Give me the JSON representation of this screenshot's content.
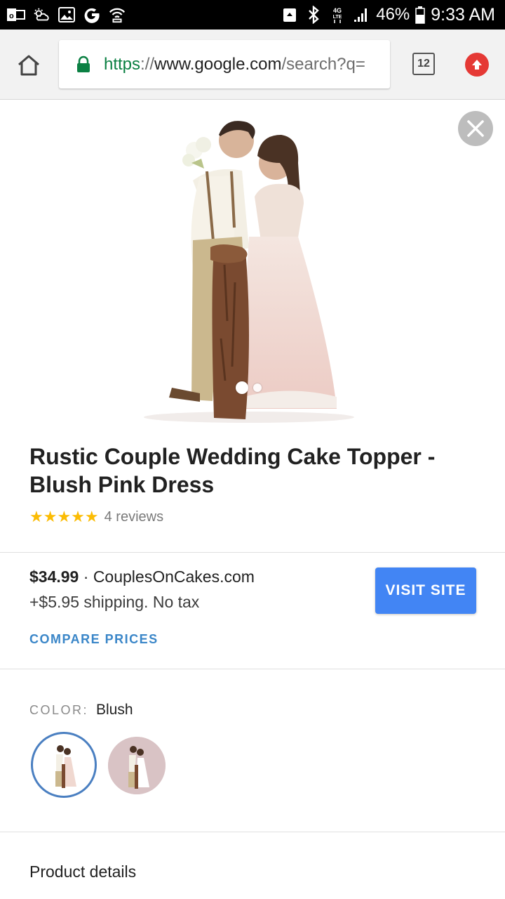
{
  "status_bar": {
    "left_icons": [
      "outlook-icon",
      "weather-icon",
      "image-icon",
      "google-icon",
      "wifi-hotspot-icon"
    ],
    "right_icons": [
      "recycle-icon",
      "bluetooth-icon",
      "4g-lte-icon",
      "signal-icon",
      "battery-icon"
    ],
    "network": "4G",
    "battery": "46%",
    "time": "9:33 AM"
  },
  "browser": {
    "url_scheme": "https",
    "url_sep": "://",
    "url_host": "www.google.com",
    "url_path": "/search?q=",
    "tab_count": "12"
  },
  "product": {
    "title": "Rustic Couple Wedding Cake Topper - Blush Pink Dress",
    "stars": "★★★★★",
    "rating": 5,
    "reviews": "4 reviews",
    "carousel_count": 2,
    "carousel_active": 1
  },
  "offer": {
    "price": "$34.99",
    "separator": " · ",
    "seller": "CouplesOnCakes.com",
    "shipping": "+$5.95 shipping. No tax",
    "visit_label": "VISIT SITE",
    "compare_label": "COMPARE PRICES"
  },
  "variant": {
    "color_label": "COLOR:",
    "color_value": "Blush"
  },
  "details": {
    "title": "Product details"
  },
  "colors": {
    "accent": "#4285f4",
    "link": "#3a86c8",
    "star": "#fbbc04",
    "update": "#e53935"
  }
}
